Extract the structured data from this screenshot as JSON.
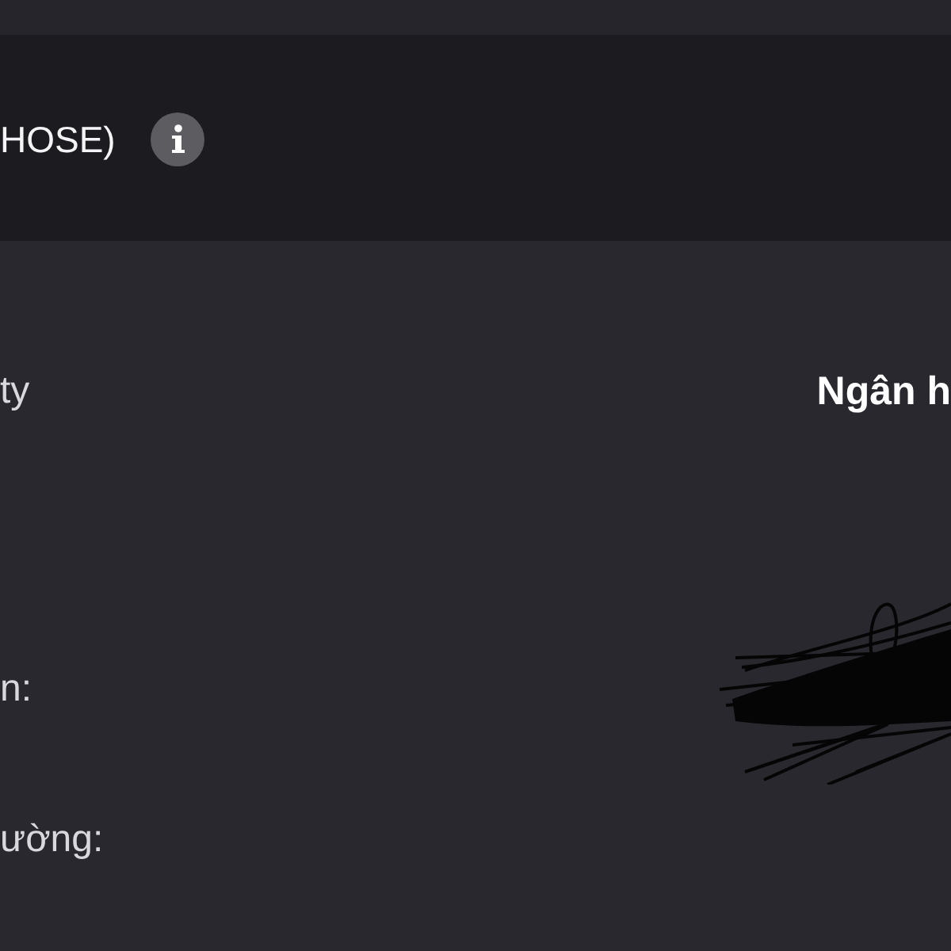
{
  "header": {
    "title": "HOSE)"
  },
  "details": [
    {
      "label": "ty",
      "value": "Ngân h",
      "redacted": false
    },
    {
      "label": "n:",
      "redacted": true
    },
    {
      "label": "ường:",
      "redacted": false
    }
  ]
}
